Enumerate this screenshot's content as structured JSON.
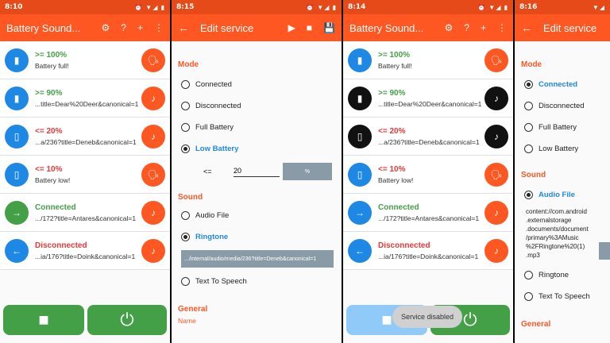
{
  "colors": {
    "accent": "#ff5722",
    "green": "#43a047",
    "red": "#e53935",
    "blue": "#1e88e5",
    "selected": "#1e88e5"
  },
  "screen1": {
    "time": "8:10",
    "title": "Battery Sound...",
    "rows": [
      {
        "title": "&gt;= 100%",
        "sub": "Battery full!",
        "icon": "battery-full-icon",
        "glyph": "▮",
        "action": "tts"
      },
      {
        "title": "&gt;= 90%",
        "sub": "...title=Dear%20Deer&canonical=1",
        "icon": "battery-90-icon",
        "glyph": "▮",
        "action": "music"
      },
      {
        "title": "&lt;= 20%",
        "sub": "...a/236?title=Deneb&canonical=1",
        "icon": "battery-20-icon",
        "glyph": "▯",
        "action": "music"
      },
      {
        "title": "&lt;= 10%",
        "sub": "Battery low!",
        "icon": "battery-10-icon",
        "glyph": "▯",
        "action": "tts"
      },
      {
        "title": "Connected",
        "sub": ".../172?title=Antares&canonical=1",
        "icon": "connected-icon",
        "glyph": "→",
        "action": "music"
      },
      {
        "title": "Disconnected",
        "sub": "...ia/176?title=Doink&canonical=1",
        "icon": "disconnected-icon",
        "glyph": "←",
        "action": "music"
      }
    ]
  },
  "screen2": {
    "time": "8:15",
    "title": "Edit service",
    "mode_header": "Mode",
    "modes": [
      "Connected",
      "Disconnected",
      "Full Battery",
      "Low Battery"
    ],
    "threshold_op": "&lt;=",
    "threshold_value": "20",
    "threshold_unit": "%",
    "sound_header": "Sound",
    "sounds": [
      "Audio File",
      "Ringtone",
      "Text To Speech"
    ],
    "ringtone_uri": ".../internal/audio/media/236?title=Deneb&canonical=1",
    "general_header": "General",
    "name_label": "Name"
  },
  "screen3": {
    "time": "8:14",
    "title": "Battery Sound...",
    "toast": "Service disabled"
  },
  "screen4": {
    "time": "8:16",
    "title": "Edit service",
    "mode_header": "Mode",
    "modes": [
      "Connected",
      "Disconnected",
      "Full Battery",
      "Low Battery"
    ],
    "sound_header": "Sound",
    "audio_file_label": "Audio File",
    "file_path": "content://com.android\n.externalstorage\n.documents/document\n/primary%3AMusic\n%2FRingtone%20(1)\n.mp3",
    "ringtone_label": "Ringtone",
    "tts_label": "Text To Speech",
    "general_header": "General"
  }
}
